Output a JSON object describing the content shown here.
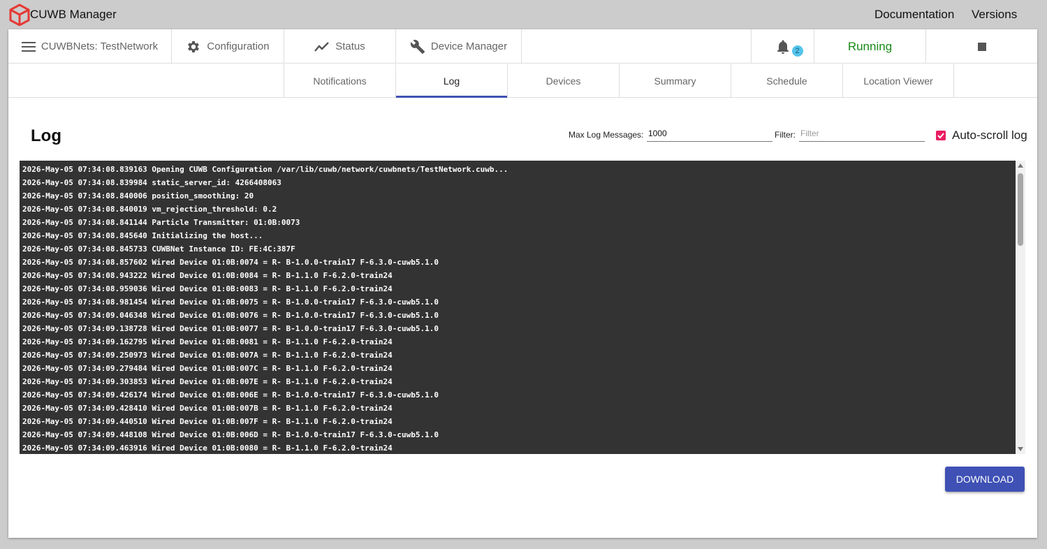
{
  "app": {
    "title": "CUWB Manager",
    "logo_icon": "cube-logo-icon",
    "brand_color": "#e53935"
  },
  "topnav": {
    "documentation": "Documentation",
    "versions": "Versions"
  },
  "navbar": {
    "network_label": "CUWBNets: TestNetwork",
    "configuration": "Configuration",
    "status": "Status",
    "device_manager": "Device Manager",
    "notification_count": "2",
    "running_status": "Running",
    "running_color": "#178a17"
  },
  "tabs": {
    "notifications": "Notifications",
    "log": "Log",
    "devices": "Devices",
    "summary": "Summary",
    "schedule": "Schedule",
    "location_viewer": "Location Viewer",
    "active": "Log",
    "active_color": "#3f51b5"
  },
  "log_panel": {
    "heading": "Log",
    "max_label": "Max Log Messages:",
    "max_value": "1000",
    "filter_label": "Filter:",
    "filter_placeholder": "Filter",
    "autoscroll_label": "Auto-scroll log",
    "autoscroll_checked": true,
    "download_label": "DOWNLOAD"
  },
  "log_lines": [
    "2026-May-05 07:34:08.839163 Opening CUWB Configuration /var/lib/cuwb/network/cuwbnets/TestNetwork.cuwb...",
    "2026-May-05 07:34:08.839984 static_server_id: 4266408063",
    "2026-May-05 07:34:08.840006 position_smoothing: 20",
    "2026-May-05 07:34:08.840019 vm_rejection_threshold: 0.2",
    "2026-May-05 07:34:08.841144 Particle Transmitter: 01:0B:0073",
    "2026-May-05 07:34:08.845640 Initializing the host...",
    "2026-May-05 07:34:08.845733 CUWBNet Instance ID: FE:4C:387F",
    "2026-May-05 07:34:08.857602 Wired Device 01:0B:0074 = R- B-1.0.0-train17 F-6.3.0-cuwb5.1.0",
    "2026-May-05 07:34:08.943222 Wired Device 01:0B:0084 = R- B-1.1.0 F-6.2.0-train24",
    "2026-May-05 07:34:08.959036 Wired Device 01:0B:0083 = R- B-1.1.0 F-6.2.0-train24",
    "2026-May-05 07:34:08.981454 Wired Device 01:0B:0075 = R- B-1.0.0-train17 F-6.3.0-cuwb5.1.0",
    "2026-May-05 07:34:09.046348 Wired Device 01:0B:0076 = R- B-1.0.0-train17 F-6.3.0-cuwb5.1.0",
    "2026-May-05 07:34:09.138728 Wired Device 01:0B:0077 = R- B-1.0.0-train17 F-6.3.0-cuwb5.1.0",
    "2026-May-05 07:34:09.162795 Wired Device 01:0B:0081 = R- B-1.1.0 F-6.2.0-train24",
    "2026-May-05 07:34:09.250973 Wired Device 01:0B:007A = R- B-1.1.0 F-6.2.0-train24",
    "2026-May-05 07:34:09.279484 Wired Device 01:0B:007C = R- B-1.1.0 F-6.2.0-train24",
    "2026-May-05 07:34:09.303853 Wired Device 01:0B:007E = R- B-1.1.0 F-6.2.0-train24",
    "2026-May-05 07:34:09.426174 Wired Device 01:0B:006E = R- B-1.0.0-train17 F-6.3.0-cuwb5.1.0",
    "2026-May-05 07:34:09.428410 Wired Device 01:0B:007B = R- B-1.1.0 F-6.2.0-train24",
    "2026-May-05 07:34:09.440510 Wired Device 01:0B:007F = R- B-1.1.0 F-6.2.0-train24",
    "2026-May-05 07:34:09.448108 Wired Device 01:0B:006D = R- B-1.0.0-train17 F-6.3.0-cuwb5.1.0",
    "2026-May-05 07:34:09.463916 Wired Device 01:0B:0080 = R- B-1.1.0 F-6.2.0-train24"
  ]
}
